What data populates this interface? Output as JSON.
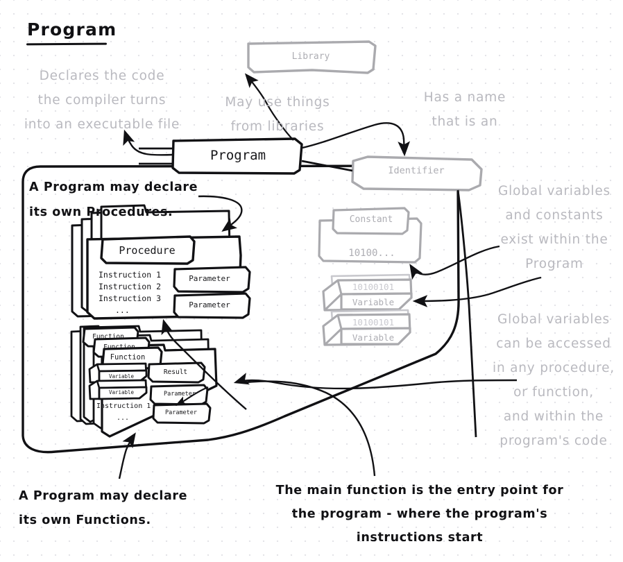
{
  "title": "Program",
  "notes": {
    "left": "Declares the code\nthe compiler turns\ninto an executable file",
    "library": "May use things\nfrom libraries",
    "name": "Has a name\nthat is an",
    "global_exists": "Global variables\nand constants\nexist within the\nProgram",
    "global_access": "Global variables\ncan be accessed\nin any procedure,\nor function,\nand within the\nprogram's code"
  },
  "captions": {
    "procedures": "A Program may declare\nits own Procedures.",
    "functions": "A Program may declare\nits own Functions.",
    "main": "The main function is the entry point for\nthe program - where the program's\ninstructions start"
  },
  "nodes": {
    "library": "Library",
    "program": "Program",
    "identifier": "Identifier",
    "constant": "Constant",
    "constant_value": "10100...",
    "variable_1": "Variable",
    "variable_2": "Variable",
    "variable_bits_1": "10100101",
    "variable_bits_2": "10100101"
  },
  "procedure_card": {
    "header": "Procedure",
    "instructions": [
      "Instruction 1",
      "Instruction 2",
      "Instruction 3"
    ],
    "ellipsis": "...",
    "parameters": [
      "Parameter",
      "Parameter"
    ]
  },
  "function_card": {
    "headers": [
      "Function",
      "Function",
      "Function"
    ],
    "variables": [
      "Variable",
      "Variable"
    ],
    "instruction": "Instruction 1",
    "ellipsis": "...",
    "result": "Result",
    "parameters": [
      "Parameter",
      "Parameter"
    ]
  },
  "colors": {
    "ink": "#111114",
    "gray_ink": "#b9b9bf",
    "node_gray": "#aaaaae",
    "dot_grid": "#e3e3e8",
    "paper": "#ffffff"
  }
}
